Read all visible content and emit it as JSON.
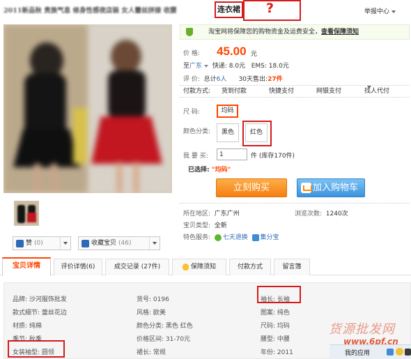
{
  "header": {
    "title": "2011新品秋 贵族气息 修身性感夜店装 女人蕾丝拼接 收腰",
    "title_highlight": "连衣裙",
    "question_mark": "?",
    "report": "举报中心"
  },
  "gallery": {
    "like_label": "赞",
    "like_count": "(0)",
    "collect_label": "收藏宝贝",
    "collect_count": "(46)"
  },
  "safety": {
    "text": "淘宝网将保障您的购物资金及运费安全，",
    "link": "查看保障须知"
  },
  "price": {
    "label": "价  格:",
    "value": "45.00",
    "unit": "元"
  },
  "shipping": {
    "to": "至",
    "city": "广东",
    "express": "快递: 8.0元",
    "ems": "EMS: 18.0元"
  },
  "evaluation": {
    "label": "评  价:",
    "total_prefix": "总计",
    "total_count": "6人",
    "sold_prefix": "30天售出:",
    "sold_count": "27件"
  },
  "payment": {
    "label": "付款方式:",
    "methods": [
      "货到付款",
      "快捷支付",
      "网银支付",
      "找人代付"
    ]
  },
  "sku": {
    "size_label": "尺  码:",
    "size_value": "均码",
    "color_label": "颜色分类:",
    "colors": [
      "黑色",
      "红色"
    ]
  },
  "quantity": {
    "label": "我 要 买:",
    "value": "1",
    "unit": "件 (库存170件)"
  },
  "selected": {
    "label": "已选择:",
    "value": "\"均码\""
  },
  "actions": {
    "buy": "立刻购买",
    "cart": "加入购物车"
  },
  "info": {
    "location_label": "所在地区:",
    "location": "广东广州",
    "views_label": "浏览次数:",
    "views": "1240次",
    "type_label": "宝贝类型:",
    "type": "全新",
    "services_label": "特色服务:",
    "service1": "七天退换",
    "service2": "集分宝"
  },
  "tabs": [
    {
      "label": "宝贝详情"
    },
    {
      "label": "评价详情(6)"
    },
    {
      "label": "成交记录 (27件)"
    },
    {
      "label": "保障须知"
    },
    {
      "label": "付款方式"
    },
    {
      "label": "留言簿"
    }
  ],
  "attributes": [
    "品牌: 沙河服饰批发",
    "货号: 0196",
    "袖长: 长袖",
    "款式细节: 蕾丝花边",
    "风格: 欧美",
    "图案: 纯色",
    "材质: 纯棉",
    "颜色分类: 黑色 红色",
    "尺码: 均码",
    "季节: 秋季",
    "价格区间: 31-70元",
    "腰型: 中腰",
    "女装袖型: 圆领",
    "裙长: 常规",
    "年份: 2011"
  ],
  "watermark": {
    "line1": "货源批发网",
    "line2": "www.6pf.cn"
  },
  "taskbar": {
    "label": "我的应用"
  },
  "colors": {
    "price": "#ff4400",
    "annotation_red": "#d41a1a",
    "buy_button": "#f57f10",
    "cart_button": "#3b92dd",
    "link_blue": "#2d6bb8"
  }
}
